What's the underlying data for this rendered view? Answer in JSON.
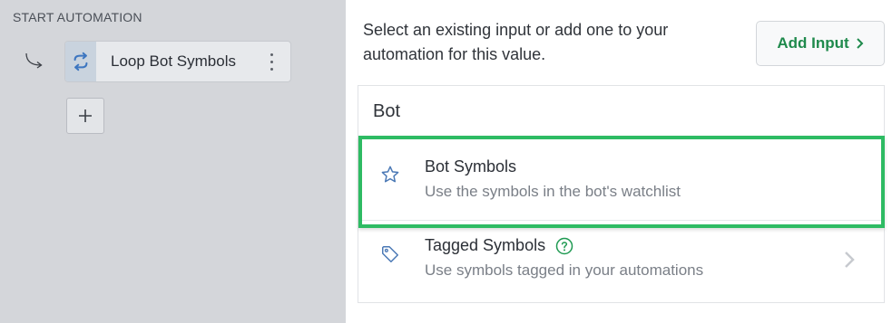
{
  "canvas": {
    "section_label": "START AUTOMATION",
    "step": {
      "label": "Loop Bot Symbols",
      "icon": "loop-icon",
      "menu_icon": "more-vertical-icon"
    },
    "add_step_icon": "plus-icon",
    "connector_icon": "curved-arrow-icon"
  },
  "panel": {
    "description": "Select an existing input or add one to your automation for this value.",
    "add_input_label": "Add Input",
    "add_input_icon": "chevron-right-icon",
    "group_title": "Bot",
    "items": [
      {
        "title": "Bot Symbols",
        "subtitle": "Use the symbols in the bot's watchlist",
        "icon": "star-icon",
        "highlighted": true
      },
      {
        "title": "Tagged Symbols",
        "subtitle": "Use symbols tagged in your automations",
        "icon": "tag-icon",
        "help_icon": "help-circle-icon",
        "chevron": "chevron-right-icon"
      }
    ]
  },
  "colors": {
    "accent_green": "#1f8a4c",
    "highlight_green": "#2ebb63",
    "icon_blue": "#4a78b5",
    "help_green": "#1f9a52"
  }
}
